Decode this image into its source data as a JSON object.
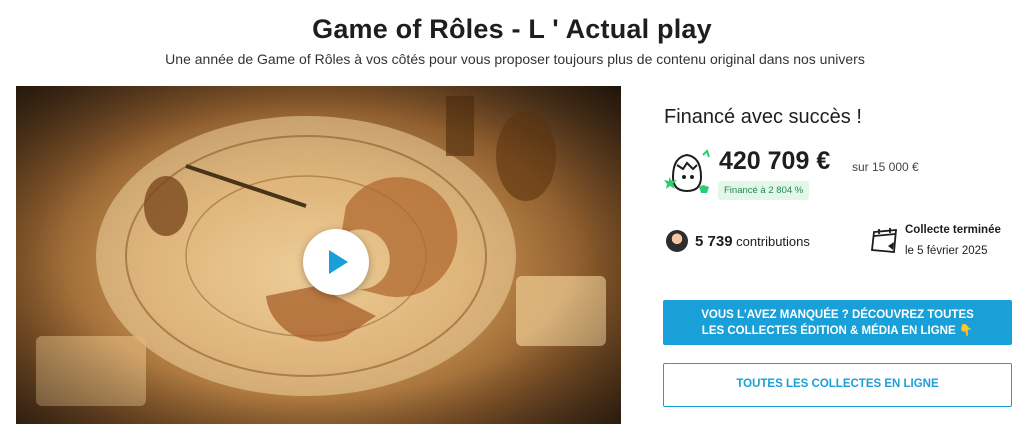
{
  "project": {
    "title": "Game of Rôles - L ' Actual play",
    "subtitle": "Une année de Game of Rôles à vos côtés pour vous proposer toujours plus de contenu original dans nos univers"
  },
  "funding": {
    "status": "Financé avec succès !",
    "amount": "420 709 €",
    "goal": "sur 15 000 €",
    "percent_badge": "Financé à 2 804 %",
    "contributions_count": "5 739",
    "contributions_label": "contributions",
    "ended_label": "Collecte terminée",
    "ended_date": "le 5 février 2025"
  },
  "actions": {
    "primary_line1": "VOUS L'AVEZ MANQUÉE ? DÉCOUVREZ TOUTES",
    "primary_line2": "LES COLLECTES ÉDITION & MÉDIA EN LIGNE 👇",
    "secondary": "TOUTES LES COLLECTES EN LIGNE"
  },
  "colors": {
    "accent": "#1aa0d8",
    "success_bg": "#e3f6ea",
    "success_text": "#1e8c4e",
    "text": "#1e1e1e"
  },
  "icons": {
    "play": "play-icon",
    "mascot": "egg-mascot-icon",
    "avatar": "avatar",
    "calendar": "calendar-icon"
  }
}
